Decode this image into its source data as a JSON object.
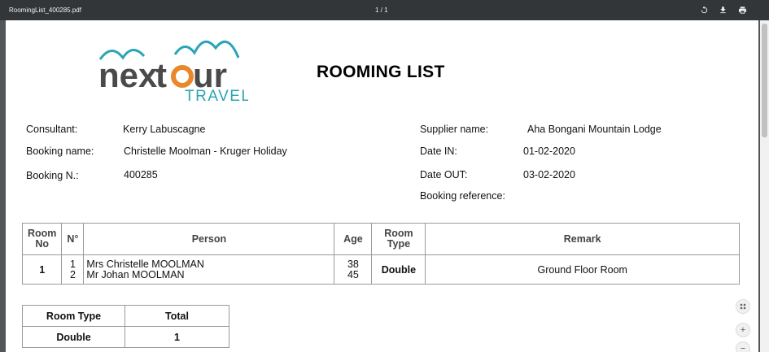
{
  "toolbar": {
    "filename": "RoomingList_400285.pdf",
    "page_indicator": "1 / 1",
    "rotate_icon": "rotate-icon",
    "download_icon": "download-icon",
    "print_icon": "print-icon"
  },
  "logo": {
    "brand": "nextour",
    "subtitle": "TRAVEL",
    "colors": {
      "arches": "#2aa5b5",
      "text": "#4a4a4a",
      "o_ring": "#e8882a",
      "travel": "#2aa5b5"
    }
  },
  "document": {
    "title": "ROOMING LIST",
    "left_info": [
      {
        "label": "Consultant:",
        "value": "Kerry Labuscagne"
      },
      {
        "label": "Booking name:",
        "value": "Christelle Moolman - Kruger Holiday"
      },
      {
        "label": "Booking N.:",
        "value": "400285"
      }
    ],
    "right_info": [
      {
        "label": "Supplier name:",
        "value": "Aha Bongani Mountain Lodge"
      },
      {
        "label": "Date IN:",
        "value": "01-02-2020"
      },
      {
        "label": "Date OUT:",
        "value": "03-02-2020"
      },
      {
        "label": "Booking reference:",
        "value": ""
      }
    ],
    "rooming_table": {
      "headers": [
        "Room No",
        "N°",
        "Person",
        "Age",
        "Room Type",
        "Remark"
      ],
      "rows": [
        {
          "room_no": "1",
          "numbers": [
            "1",
            "2"
          ],
          "persons": [
            "Mrs Christelle MOOLMAN",
            "Mr Johan MOOLMAN"
          ],
          "ages": [
            "38",
            "45"
          ],
          "room_type": "Double",
          "remark": "Ground Floor Room"
        }
      ]
    },
    "summary_table": {
      "headers": [
        "Room Type",
        "Total"
      ],
      "rows": [
        {
          "room_type": "Double",
          "total": "1"
        }
      ]
    }
  },
  "viewer_controls": {
    "fit_icon": "fit-page-icon",
    "zoom_in_label": "+",
    "zoom_out_label": "−"
  }
}
